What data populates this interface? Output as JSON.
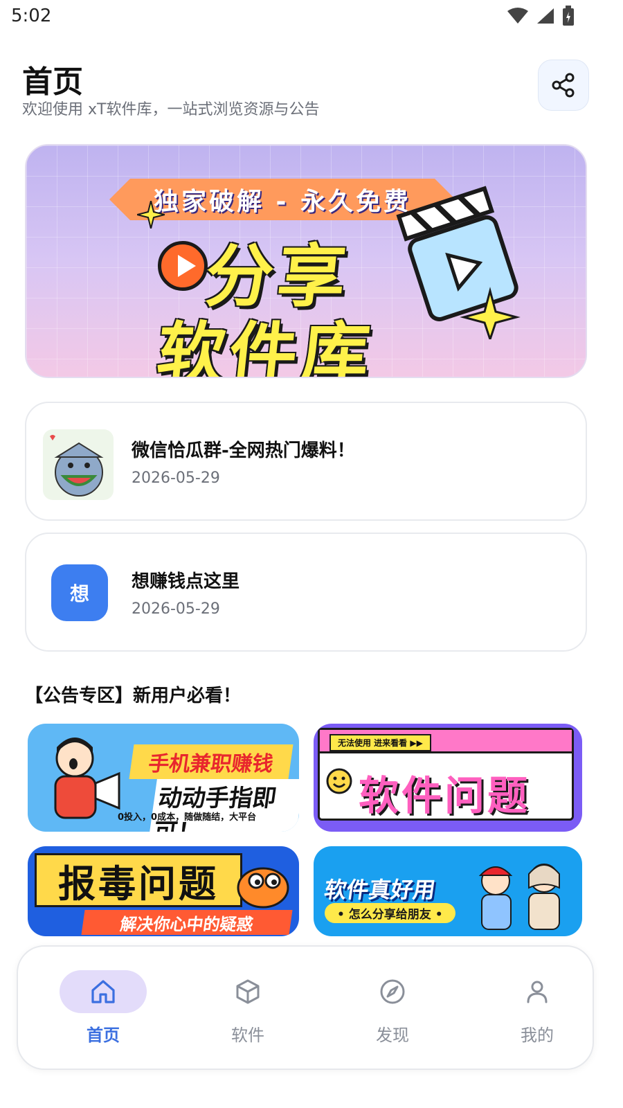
{
  "status_bar": {
    "time": "5:02",
    "icons": [
      "wifi-icon",
      "signal-icon",
      "battery-icon"
    ]
  },
  "header": {
    "title": "首页",
    "subtitle": "欢迎使用 xT软件库，一站式浏览资源与公告",
    "share_icon": "share-icon"
  },
  "hero": {
    "ribbon": "独家破解 - 永久免费",
    "line1": "分享",
    "line2": "软件库"
  },
  "cards": [
    {
      "title": "微信恰瓜群-全网热门爆料！",
      "date": "2026-05-29",
      "thumb": "shark-watermelon"
    },
    {
      "title": "想赚钱点这里",
      "date": "2026-05-29",
      "thumb_letter": "想"
    }
  ],
  "notice": {
    "section_title": "【公告专区】新用户必看！"
  },
  "promos": [
    {
      "title": "手机兼职赚钱",
      "sub": "动动手指即可！",
      "foot": "0投入，0成本，随做随结，大平台"
    },
    {
      "tag": "无法使用 进来看看 ▶▶",
      "title": "软件问题"
    },
    {
      "title": "报毒问题",
      "sub": "解决你心中的疑惑"
    },
    {
      "title": "软件真好用",
      "sub": "• 怎么分享给朋友 •"
    }
  ],
  "nav": {
    "items": [
      {
        "label": "首页",
        "icon": "home-icon",
        "active": true
      },
      {
        "label": "软件",
        "icon": "box-icon",
        "active": false
      },
      {
        "label": "发现",
        "icon": "compass-icon",
        "active": false
      },
      {
        "label": "我的",
        "icon": "user-icon",
        "active": false
      }
    ]
  },
  "colors": {
    "accent": "#3b6fe0",
    "active_pill": "#e3dcfa",
    "letter_badge": "#3d7ef0"
  }
}
